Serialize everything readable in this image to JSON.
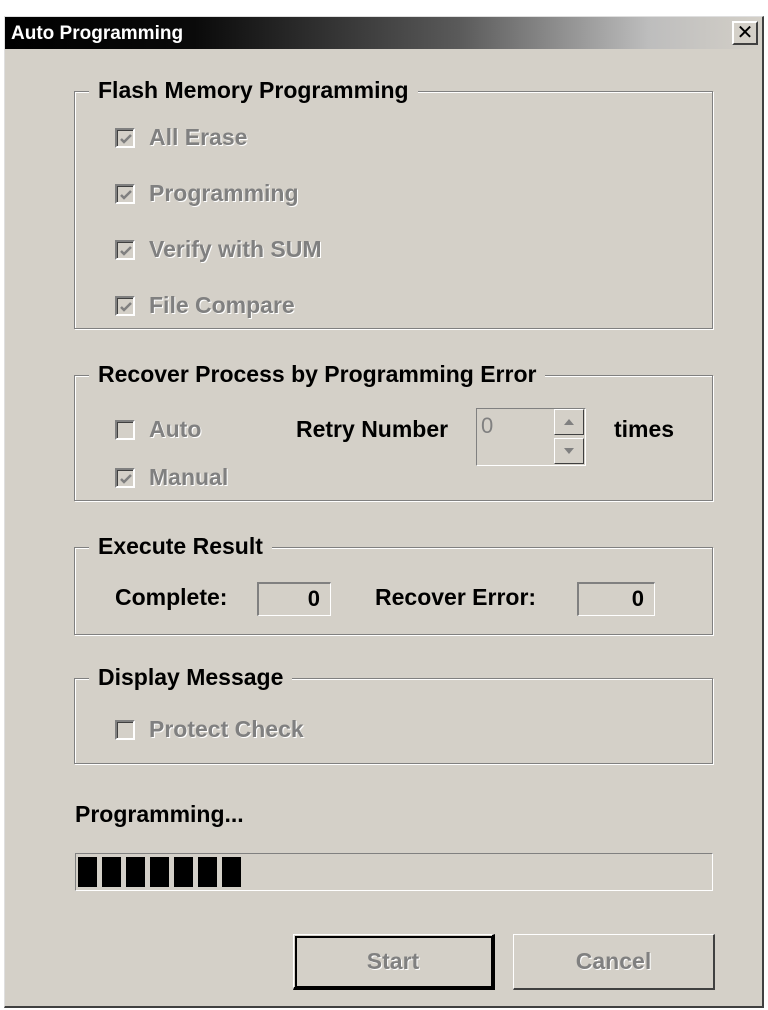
{
  "window": {
    "title": "Auto Programming",
    "close_glyph": "✕"
  },
  "flash_group": {
    "label": "Flash Memory Programming",
    "items": [
      {
        "label": "All Erase",
        "checked": true
      },
      {
        "label": "Programming",
        "checked": true
      },
      {
        "label": "Verify with SUM",
        "checked": true
      },
      {
        "label": "File Compare",
        "checked": true
      }
    ]
  },
  "recover_group": {
    "label": "Recover Process by Programming Error",
    "auto": {
      "label": "Auto",
      "checked": false
    },
    "manual": {
      "label": "Manual",
      "checked": true
    },
    "retry_label": "Retry Number",
    "retry_value": "0",
    "times_label": "times"
  },
  "result_group": {
    "label": "Execute Result",
    "complete_label": "Complete:",
    "complete_value": "0",
    "recover_error_label": "Recover Error:",
    "recover_error_value": "0"
  },
  "message_group": {
    "label": "Display Message",
    "protect_check": {
      "label": "Protect Check",
      "checked": false
    }
  },
  "status_text": "Programming...",
  "progress": {
    "filled_blocks": 7
  },
  "buttons": {
    "start": "Start",
    "cancel": "Cancel"
  },
  "colors": {
    "disabled_text": "#808080",
    "face": "#d4d0c8",
    "progress_block": "#000000"
  }
}
